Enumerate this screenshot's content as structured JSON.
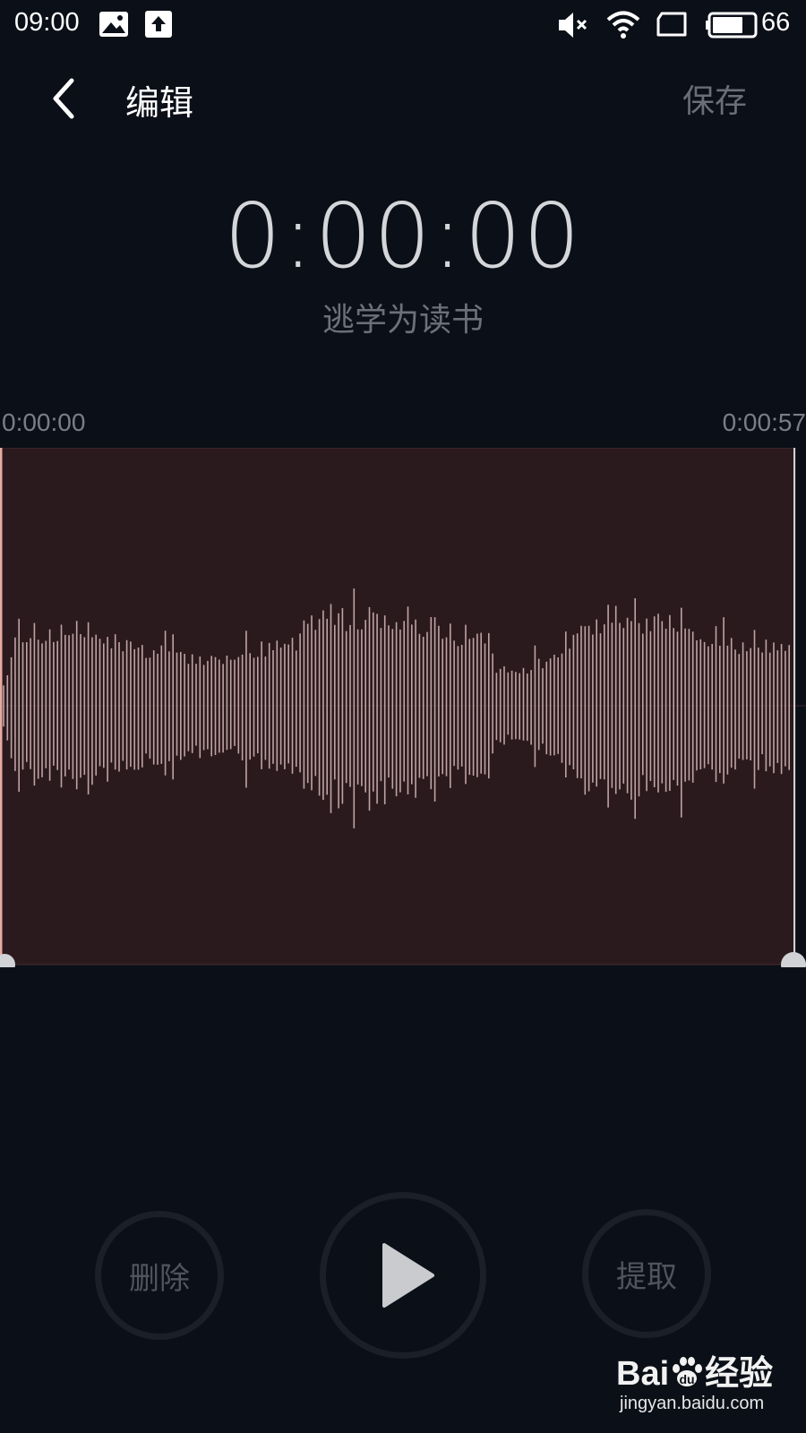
{
  "status_bar": {
    "time": "09:00",
    "battery_level": "66",
    "icons": [
      "image-icon",
      "upload-icon",
      "mute-icon",
      "wifi-icon",
      "tablet-icon",
      "battery-icon"
    ]
  },
  "header": {
    "title": "编辑",
    "save_label": "保存",
    "back_icon": "chevron-left-icon"
  },
  "playback": {
    "current_time": "0:00:00",
    "recording_name": "逃学为读书"
  },
  "timeline": {
    "start": "0:00:00",
    "end": "0:00:57"
  },
  "selection": {
    "start_fraction": 0,
    "end_fraction": 1
  },
  "controls": {
    "delete_label": "删除",
    "extract_label": "提取",
    "play_icon": "play-icon"
  },
  "colors": {
    "background": "#0b0f17",
    "selection_fill": "#2b1a1d",
    "waveform": "#bfa3a5",
    "playhead": "#e7a9a0",
    "handle": "#d0d2d6"
  },
  "watermark": {
    "logo_text": "Bai",
    "logo_text_2": "经验",
    "url": "jingyan.baidu.com"
  }
}
